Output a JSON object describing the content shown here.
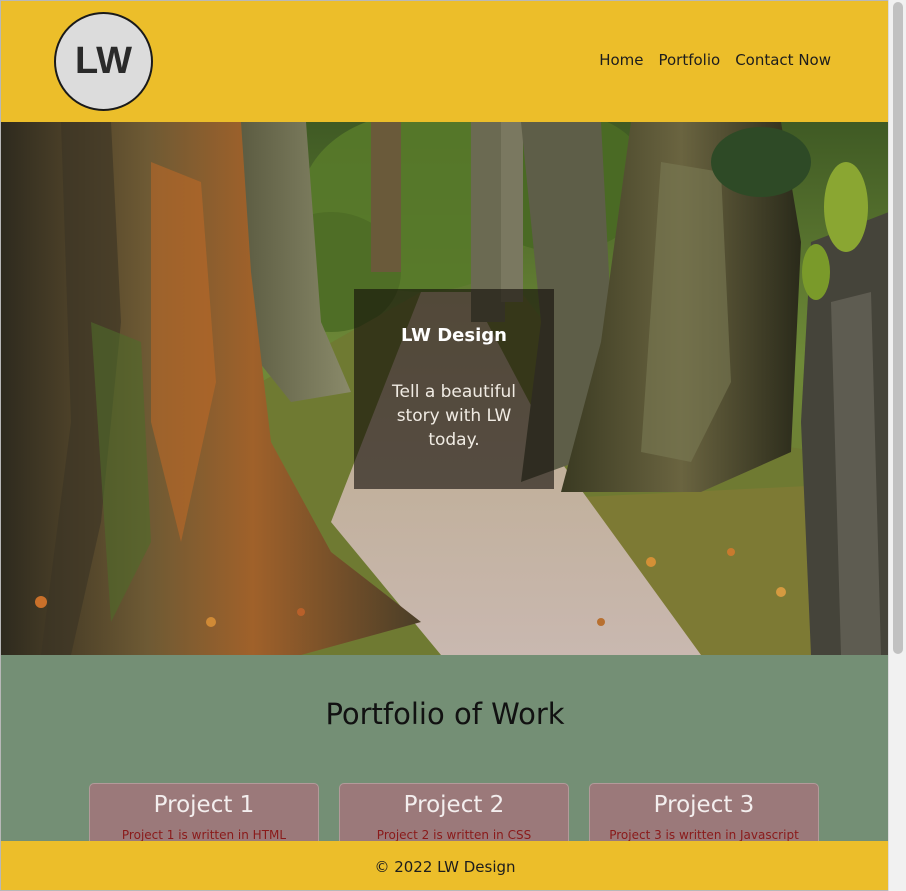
{
  "header": {
    "logo_text": "LW",
    "nav": [
      {
        "label": "Home"
      },
      {
        "label": "Portfolio"
      },
      {
        "label": "Contact Now"
      }
    ]
  },
  "hero": {
    "image": "forest-path-photo",
    "title": "LW Design",
    "tagline": "Tell a beautiful story with LW today."
  },
  "portfolio": {
    "title": "Portfolio of Work",
    "projects": [
      {
        "name": "Project 1",
        "desc": "Project 1 is written in HTML"
      },
      {
        "name": "Project 2",
        "desc": "Project 2 is written in CSS"
      },
      {
        "name": "Project 3",
        "desc": "Project 3 is written in Javascript"
      }
    ]
  },
  "footer": {
    "text": "© 2022 LW Design"
  },
  "colors": {
    "header_bg": "#ecbe2a",
    "portfolio_bg": "#748f75",
    "card_bg": "#9b797a"
  }
}
